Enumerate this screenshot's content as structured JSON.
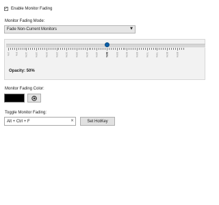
{
  "enable_fading": {
    "label": "Enable Monitor Fading",
    "checked": true
  },
  "mode": {
    "label": "Monitor Fading Mode:",
    "selected": "Fade Non-Current Monitors"
  },
  "opacity": {
    "label": "Opacity: 50%",
    "value_percent": 50,
    "min_percent": 1,
    "max_percent": 99,
    "tick_labels": [
      "1%",
      "5%",
      "10%",
      "15%",
      "20%",
      "25%",
      "30%",
      "35%",
      "40%",
      "45%",
      "50%",
      "55%",
      "60%",
      "65%",
      "70%",
      "75%",
      "80%",
      "85%"
    ]
  },
  "color": {
    "label": "Monitor Fading Color:",
    "value": "#000000",
    "picker_icon": "color-picker-icon"
  },
  "toggle": {
    "label": "Toggle Monitor Fading:",
    "hotkey_value": "Alt + Ctrl + F",
    "clear_glyph": "×",
    "set_button": "Set HotKey"
  },
  "colors": {
    "accent": "#0b5fa8",
    "panel": "#f2f2f2"
  }
}
